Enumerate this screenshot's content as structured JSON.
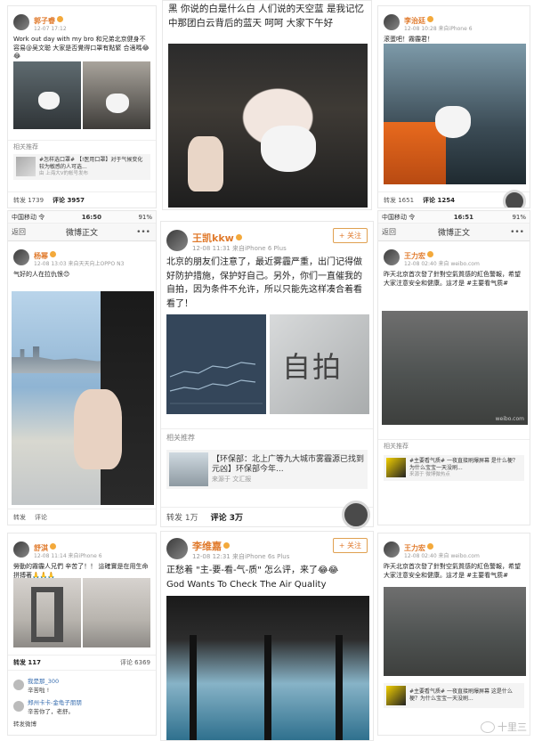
{
  "top_left": {
    "user": "郭子睿",
    "time": "12-07 17:12",
    "text": "Work out day with my bro 和兄弟北京健身不容易@吴文聪 大家是否覺得口罩有點緊 合適嗎😂😂",
    "related_head": "相关推荐",
    "related_title": "#怎样选口罩# 【!医用口罩】对于气候变化较为敏感的人可选...",
    "related_src": "由 上海大V的帐号发布",
    "actions": [
      "转发 1739",
      "评论 3957"
    ]
  },
  "top_mid": {
    "text": "黑 你说的白是什么白 人们说的天空蓝 是我记忆中那团白云背后的蓝天 呵呵 大家下午好"
  },
  "top_right": {
    "user": "李治廷",
    "time": "12-08 10:28 来自iPhone 6",
    "text": "滚蛋吧！霧霾君！",
    "actions": [
      "转发 1651",
      "评论 1254"
    ]
  },
  "mid_left": {
    "status_carrier": "中国移动 令",
    "status_time": "16:50",
    "status_battery": "91%",
    "nav_back": "返回",
    "nav_title": "微博正文",
    "user": "杨幂",
    "time": "12-08 13:03 来自天天向上OPPO N3",
    "text": "气好的人在拉仇恨😊",
    "actions": [
      "转发",
      "评论"
    ]
  },
  "mid_center": {
    "user": "王凯kkw",
    "time": "12-08 11:31 来自iPhone 6 Plus",
    "follow": "+ 关注",
    "text": "北京的朋友们注意了，最近雾霾严重，出门记得做好防护措施，保护好自己。另外，你们一直催我的自拍，因为条件不允许，所以只能先这样凑合着看看了！",
    "handwriting": "自拍",
    "related_head": "相关推荐",
    "related_title": "【环保部：北上广等九大城市雾霾源已找到元凶】环保部今年...",
    "related_src": "来源于 文汇报",
    "actions": [
      "转发 1万",
      "评论 3万"
    ]
  },
  "mid_right": {
    "status_carrier": "中国移动 令",
    "status_time": "16:51",
    "status_battery": "91%",
    "nav_back": "返回",
    "nav_title": "微博正文",
    "user": "王力宏",
    "time": "12-08 02:40 来自 weibo.com",
    "text": "昨天北京首次發了針對空氣質感的紅色警報，希望大家注意安全和健康。這才是 #主要看气质#",
    "watermark": "weibo.com",
    "related_head": "相关推荐",
    "related_title": "#主要看气质# 一夜直接刷爆屏幕 是什么梗？为什么宝宝一天没刷...",
    "related_src": "来源于 微博微热点"
  },
  "bot_left": {
    "user": "舒淇",
    "time": "12-08 11:14 来自iPhone 6",
    "text": "勞動的霧霾人兄們 辛苦了！！ 這確實是在用生命拼搏著🙏🙏🙏",
    "actions": [
      "转发 117",
      "评论 6369"
    ],
    "comment1_user": "我是那_300",
    "comment1_text": "辛苦啦 !",
    "comment2_user": "郑州卡卡-金龟子朋朋",
    "comment2_text": "辛苦你了，老舒。",
    "footer": "转发微博"
  },
  "bot_center": {
    "user": "李维嘉",
    "time": "12-08 12:31 来自iPhone 6s Plus",
    "follow": "+ 关注",
    "text_line1": "正愁着 \"主-要-看-气-质\" 怎么评，来了😂😂",
    "text_line2": "God Wants To Check The Air Quality"
  },
  "bot_right": {
    "user": "王力宏",
    "time": "12-08 02:40 来自 weibo.com",
    "text": "昨天北京首次發了針對空氣質感的紅色警報，希望大家注意安全和健康。這才是 #主要看气质#",
    "related_title": "#主要看气质# 一夜直接刷爆屏幕 这是什么梗？为什么宝宝一天没刷...",
    "wx_label": "十里三"
  }
}
